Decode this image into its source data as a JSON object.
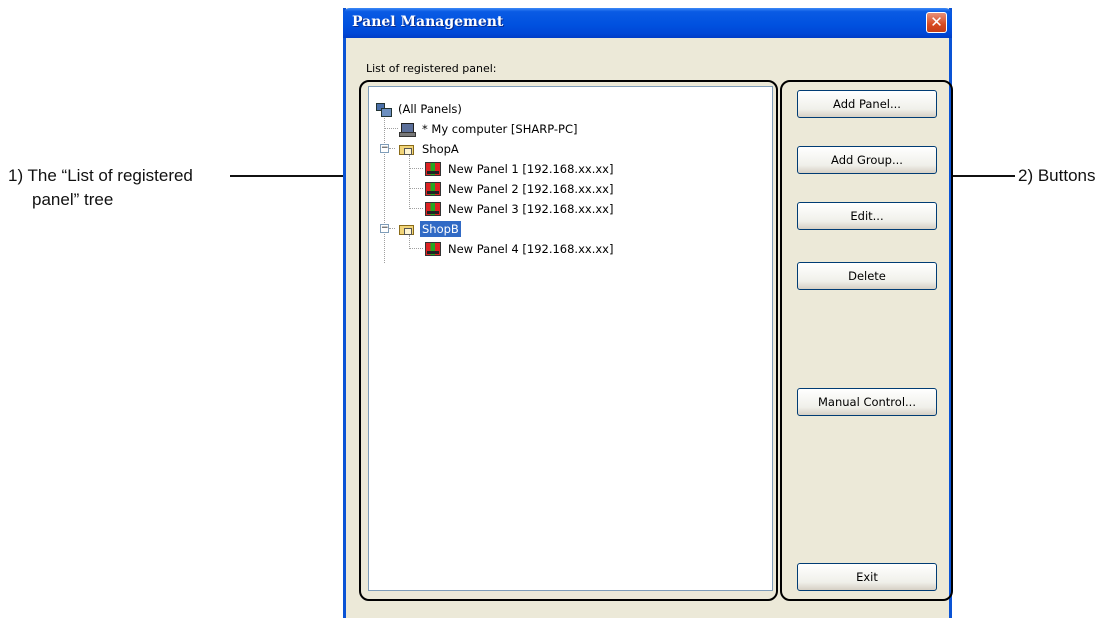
{
  "dialog": {
    "title": "Panel Management",
    "close_glyph": "✕",
    "list_label": "List of registered panel:"
  },
  "tree": {
    "nodes": [
      {
        "label": "(All Panels)",
        "icon": "all-panels-icon"
      },
      {
        "label": "* My computer [SHARP-PC]",
        "icon": "computer-icon"
      },
      {
        "label": "ShopA",
        "icon": "folder-icon",
        "expander": "−"
      },
      {
        "label": "New Panel 1 [192.168.xx.xx]",
        "icon": "panel-icon"
      },
      {
        "label": "New Panel 2 [192.168.xx.xx]",
        "icon": "panel-icon"
      },
      {
        "label": "New Panel 3 [192.168.xx.xx]",
        "icon": "panel-icon"
      },
      {
        "label": "ShopB",
        "icon": "folder-icon",
        "expander": "−",
        "selected": true
      },
      {
        "label": "New Panel 4 [192.168.xx.xx]",
        "icon": "panel-icon"
      }
    ]
  },
  "buttons": {
    "add_panel": "Add Panel...",
    "add_group": "Add Group...",
    "edit": "Edit...",
    "delete": "Delete",
    "manual_control": "Manual Control...",
    "exit": "Exit"
  },
  "callouts": {
    "left_line1": "1) The “List of registered",
    "left_line2": "panel” tree",
    "right": "2) Buttons"
  },
  "colors": {
    "titlebar": "#0051df",
    "selection": "#316ac5",
    "dialog_bg": "#ece9d8"
  }
}
